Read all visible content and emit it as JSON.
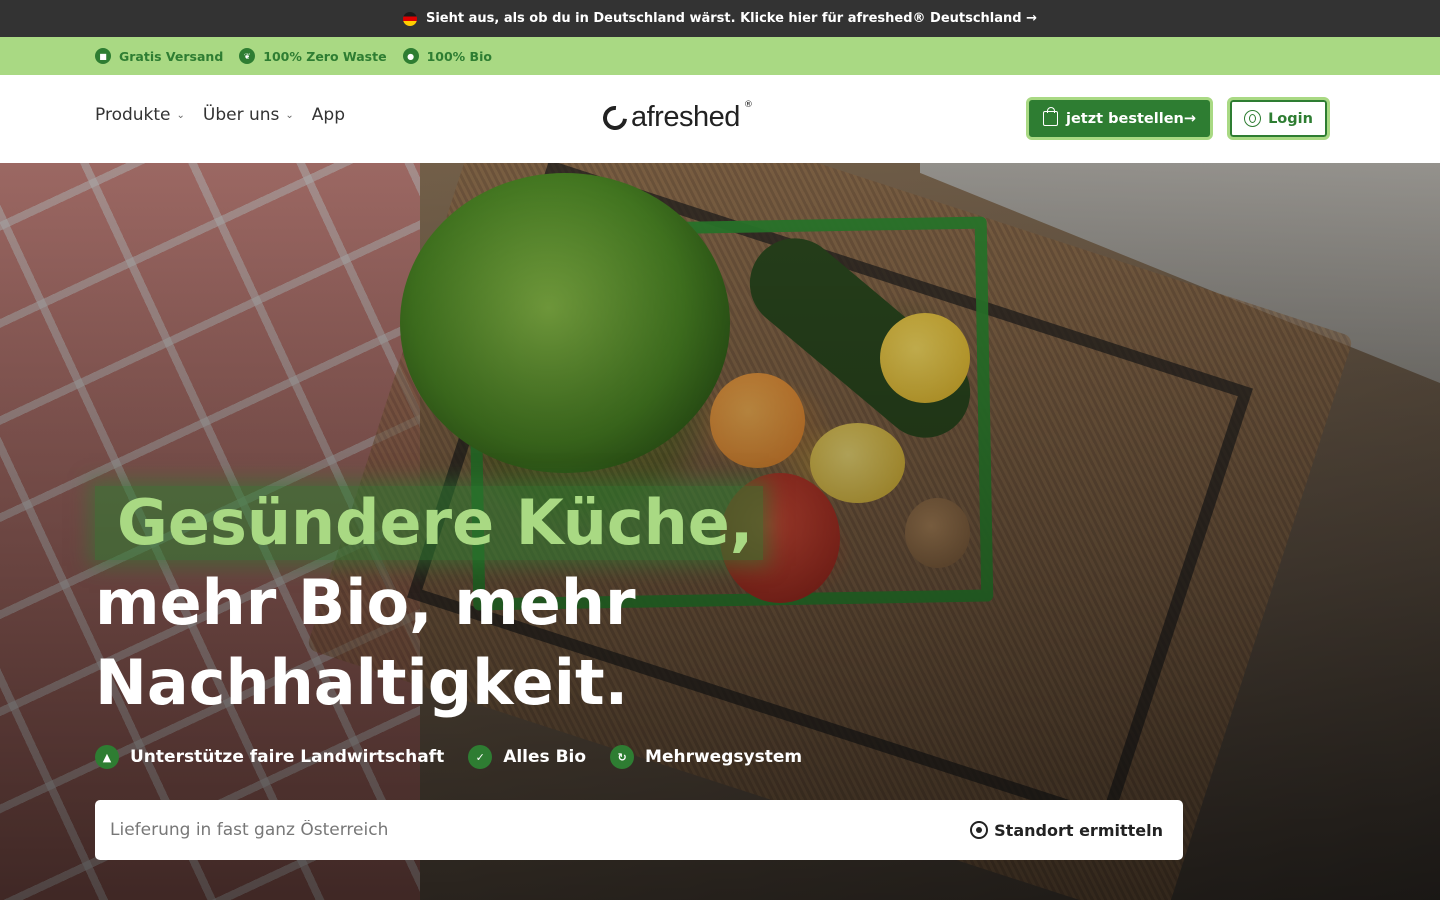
{
  "topbar": {
    "text": "Sieht aus, als ob du in Deutschland wärst. Klicke hier für afreshed® Deutschland →",
    "flag_icon": "germany-flag-icon"
  },
  "usps": [
    {
      "label": "Gratis Versand",
      "icon": "box-icon"
    },
    {
      "label": "100% Zero Waste",
      "icon": "leaf-icon"
    },
    {
      "label": "100% Bio",
      "icon": "organic-icon"
    }
  ],
  "nav": {
    "items": [
      {
        "label": "Produkte",
        "has_dropdown": true
      },
      {
        "label": "Über uns",
        "has_dropdown": true
      },
      {
        "label": "App",
        "has_dropdown": false
      }
    ],
    "dropdown_glyph": "⌄"
  },
  "logo": {
    "text": "afreshed",
    "reg": "®"
  },
  "header_actions": {
    "order_label": "jetzt bestellen→",
    "login_label": "Login"
  },
  "hero": {
    "headline_highlight": "Gesündere Küche,",
    "headline_line2": "mehr Bio, mehr",
    "headline_line3": "Nachhaltigkeit.",
    "badges": [
      {
        "label": "Unterstütze faire Landwirtschaft",
        "icon": "farm-icon"
      },
      {
        "label": "Alles Bio",
        "icon": "check-leaf-icon"
      },
      {
        "label": "Mehrwegsystem",
        "icon": "recycle-icon"
      }
    ]
  },
  "search": {
    "placeholder": "Lieferung in fast ganz Österreich",
    "value": "",
    "locate_label": "Standort ermitteln"
  },
  "colors": {
    "primary_green": "#2e7d32",
    "light_green": "#a9d983",
    "topbar_bg": "#333333"
  }
}
